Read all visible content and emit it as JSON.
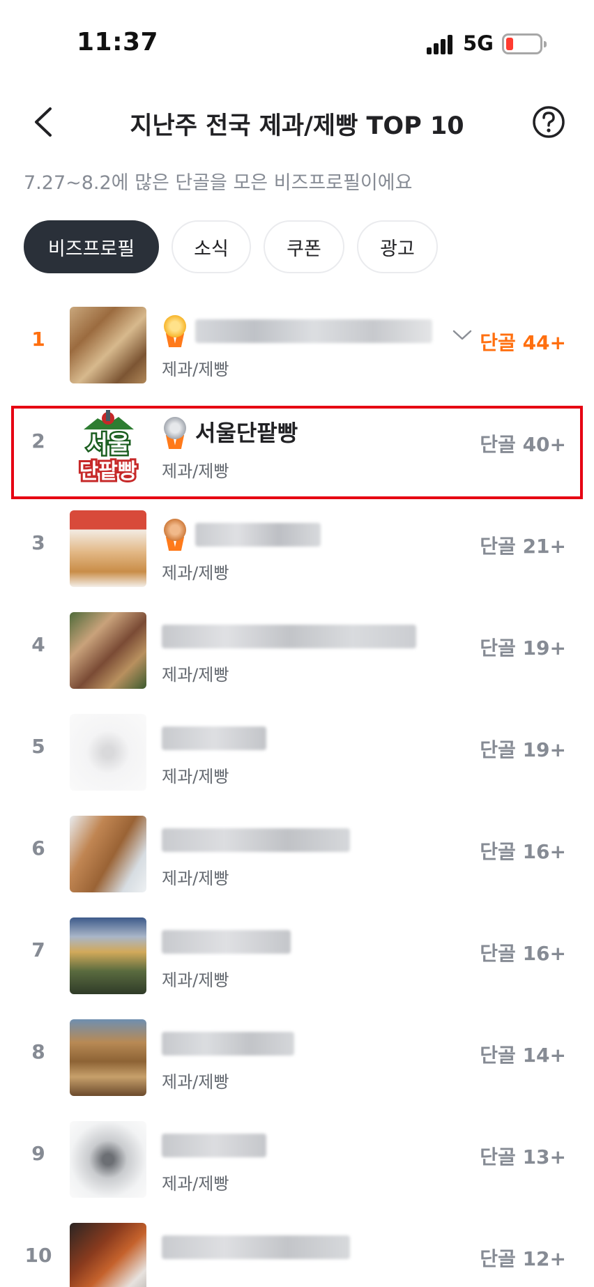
{
  "status_bar": {
    "time": "11:37",
    "network": "5G",
    "battery_color": "#ff3b30"
  },
  "header": {
    "title": "지난주 전국 제과/제빵 TOP 10",
    "back_icon": "chevron-left-icon",
    "help_icon": "question-circle-icon"
  },
  "subtitle": "7.27~8.2에 많은 단골을 모은 비즈프로필이에요",
  "tabs": [
    {
      "label": "비즈프로필",
      "active": true
    },
    {
      "label": "소식",
      "active": false
    },
    {
      "label": "쿠폰",
      "active": false
    },
    {
      "label": "광고",
      "active": false
    }
  ],
  "accent_color": "#ff6f0f",
  "highlight_color": "#e60012",
  "rows": [
    {
      "rank": "1",
      "name": "",
      "category": "제과/제빵",
      "regulars": "단골 44+",
      "medal": "gold",
      "highlight": false
    },
    {
      "rank": "2",
      "name": "서울단팥빵",
      "category": "제과/제빵",
      "regulars": "단골 40+",
      "medal": "silver",
      "highlight": true,
      "logo_text": [
        "서울",
        "단팥빵"
      ]
    },
    {
      "rank": "3",
      "name": "",
      "category": "제과/제빵",
      "regulars": "단골 21+",
      "medal": "bronze"
    },
    {
      "rank": "4",
      "name": "",
      "category": "제과/제빵",
      "regulars": "단골 19+"
    },
    {
      "rank": "5",
      "name": "",
      "category": "제과/제빵",
      "regulars": "단골 19+"
    },
    {
      "rank": "6",
      "name": "",
      "category": "제과/제빵",
      "regulars": "단골 16+"
    },
    {
      "rank": "7",
      "name": "",
      "category": "제과/제빵",
      "regulars": "단골 16+"
    },
    {
      "rank": "8",
      "name": "",
      "category": "제과/제빵",
      "regulars": "단골 14+"
    },
    {
      "rank": "9",
      "name": "",
      "category": "제과/제빵",
      "regulars": "단골 13+"
    },
    {
      "rank": "10",
      "name": "",
      "category": "",
      "regulars": "단골 12+"
    }
  ]
}
